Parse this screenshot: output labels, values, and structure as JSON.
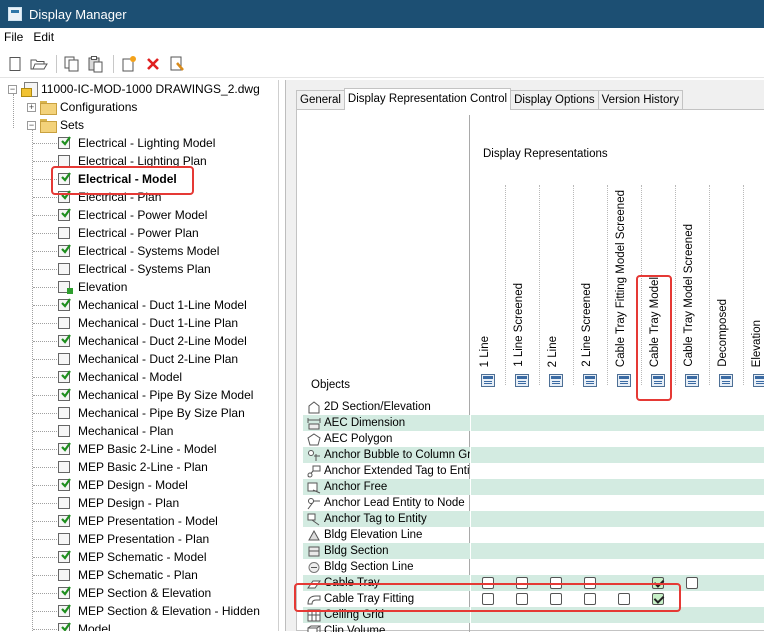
{
  "window": {
    "title": "Display Manager"
  },
  "menu": [
    "File",
    "Edit"
  ],
  "toolbar": {
    "icons": [
      "new-icon",
      "open-icon",
      "copy-icon",
      "paste-icon",
      "new-style-icon",
      "delete-icon",
      "purge-icon"
    ]
  },
  "tree": {
    "root": "11000-IC-MOD-1000 DRAWINGS_2.dwg",
    "configurations": "Configurations",
    "sets": "Sets",
    "items": [
      "Electrical - Lighting Model",
      "Electrical - Lighting Plan",
      "Electrical - Model",
      "Electrical - Plan",
      "Electrical - Power Model",
      "Electrical - Power Plan",
      "Electrical - Systems Model",
      "Electrical - Systems Plan",
      "Elevation",
      "Mechanical - Duct 1-Line Model",
      "Mechanical - Duct 1-Line Plan",
      "Mechanical - Duct 2-Line Model",
      "Mechanical - Duct 2-Line Plan",
      "Mechanical - Model",
      "Mechanical - Pipe By Size Model",
      "Mechanical - Pipe By Size Plan",
      "Mechanical - Plan",
      "MEP Basic 2-Line - Model",
      "MEP Basic 2-Line - Plan",
      "MEP Design - Model",
      "MEP Design - Plan",
      "MEP Presentation - Model",
      "MEP Presentation - Plan",
      "MEP Schematic - Model",
      "MEP Schematic - Plan",
      "MEP Section & Elevation",
      "MEP Section & Elevation - Hidden",
      "Model"
    ],
    "selected": "Electrical - Model"
  },
  "tabs": [
    "General",
    "Display Representation Control",
    "Display Options",
    "Version History"
  ],
  "active_tab": "Display Representation Control",
  "grid": {
    "display_representations_label": "Display Representations",
    "objects_label": "Objects",
    "columns": [
      "1 Line",
      "1 Line Screened",
      "2 Line",
      "2 Line Screened",
      "Cable Tray Fitting Model Screened",
      "Cable Tray Model",
      "Cable Tray Model Screened",
      "Decomposed",
      "Elevation"
    ],
    "rows": [
      {
        "name": "2D Section/Elevation",
        "icon": "section-elevation-icon",
        "checks": null
      },
      {
        "name": "AEC Dimension",
        "icon": "dimension-icon",
        "checks": null
      },
      {
        "name": "AEC Polygon",
        "icon": "polygon-icon",
        "checks": null
      },
      {
        "name": "Anchor Bubble to Column Grid",
        "icon": "anchor-bubble-icon",
        "checks": null
      },
      {
        "name": "Anchor Extended Tag to Entity",
        "icon": "anchor-tag-icon",
        "checks": null
      },
      {
        "name": "Anchor Free",
        "icon": "anchor-free-icon",
        "checks": null
      },
      {
        "name": "Anchor Lead Entity to Node",
        "icon": "anchor-lead-icon",
        "checks": null
      },
      {
        "name": "Anchor Tag to Entity",
        "icon": "anchor-tag-entity-icon",
        "checks": null
      },
      {
        "name": "Bldg Elevation Line",
        "icon": "bldg-elevation-line-icon",
        "checks": null
      },
      {
        "name": "Bldg Section",
        "icon": "bldg-section-icon",
        "checks": null
      },
      {
        "name": "Bldg Section Line",
        "icon": "bldg-section-line-icon",
        "checks": null
      },
      {
        "name": "Cable Tray",
        "icon": "cable-tray-icon",
        "checks": [
          false,
          false,
          false,
          false,
          null,
          true,
          false
        ]
      },
      {
        "name": "Cable Tray Fitting",
        "icon": "cable-tray-fitting-icon",
        "checks": [
          false,
          false,
          false,
          false,
          false,
          true
        ]
      },
      {
        "name": "Ceiling Grid",
        "icon": "ceiling-grid-icon",
        "checks": null
      },
      {
        "name": "Clip Volume",
        "icon": "clip-volume-icon",
        "checks": null
      }
    ]
  },
  "colors": {
    "title_bar": "#1c4f73",
    "row_shade": "#d3ebe1",
    "highlight": "#e53935"
  }
}
